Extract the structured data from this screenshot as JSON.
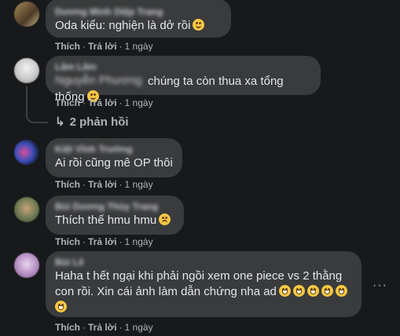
{
  "colors": {
    "background": "#18191a",
    "bubble": "#3a3b3c",
    "text": "#e4e6eb",
    "secondary_text": "#b0b3b8"
  },
  "actions": {
    "like": "Thích",
    "reply": "Trả lời",
    "time": "1 ngày",
    "separator": "·"
  },
  "comments": [
    {
      "name": "Dương Minh Diệp Trang",
      "text": "Oda kiểu: nghiện là dở rồi",
      "emoji": "smiling-face-icon"
    },
    {
      "name": "Lâm Lâm",
      "mention": "Nguyễn Phương",
      "text": "chúng ta còn thua xa tổng thống",
      "emoji": "grinning-sweat-face-icon",
      "replies_label": "2 phản hồi",
      "replies_icon": "reply-arrow-icon"
    },
    {
      "name": "Kiệt Vĩnh Trường",
      "text": "Ai rồi cũng mê OP thôi"
    },
    {
      "name": "Bùi Dương Thùy Trang",
      "text": "Thích thế hmu hmu",
      "emoji": "pensive-face-icon"
    },
    {
      "name": "Bùi Lê",
      "text_line1": "Haha t hết ngại khi phải ngồi xem one piece vs 2 thằng",
      "text_line2": "con rồi. Xin cái ảnh làm dẫn chứng nha ad",
      "emoji": "grinning-face-icon",
      "more_label": "···"
    }
  ]
}
